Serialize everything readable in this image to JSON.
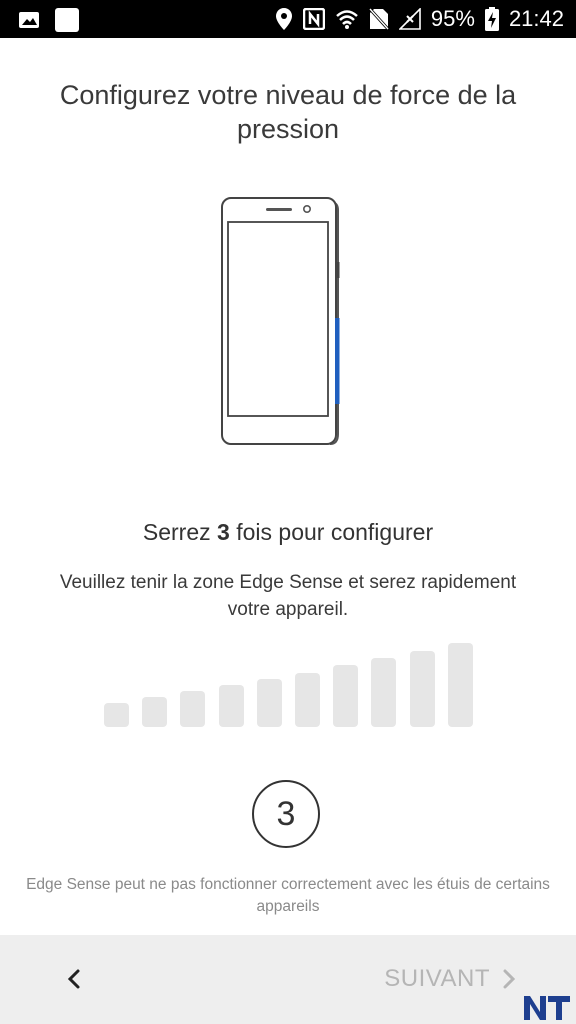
{
  "status_bar": {
    "battery_percent": "95%",
    "time": "21:42",
    "icons": [
      "image-icon",
      "square-icon",
      "location-icon",
      "nfc-icon",
      "wifi-icon",
      "no-sim-icon",
      "no-signal-icon",
      "battery-charging-icon"
    ]
  },
  "title": "Configurez votre niveau de force de la pression",
  "squeeze": {
    "prefix": "Serrez ",
    "count": "3",
    "suffix": " fois pour configurer"
  },
  "instruction": "Veuillez tenir la zone Edge Sense et serez rapidement votre appareil.",
  "level_bars": {
    "count": 10,
    "filled": 0
  },
  "counter_value": "3",
  "warning": "Edge Sense peut ne pas fonctionner correctement avec les étuis de certains appareils",
  "nav": {
    "back_icon": "chevron-left-icon",
    "next_label": "SUIVANT",
    "next_icon": "chevron-right-icon"
  },
  "colors": {
    "accent_edge": "#1f5fbf",
    "bar_inactive": "#e6e6e6",
    "next_disabled": "#b5b5b5",
    "navbar_bg": "#eeeeee"
  },
  "watermark": "NT"
}
